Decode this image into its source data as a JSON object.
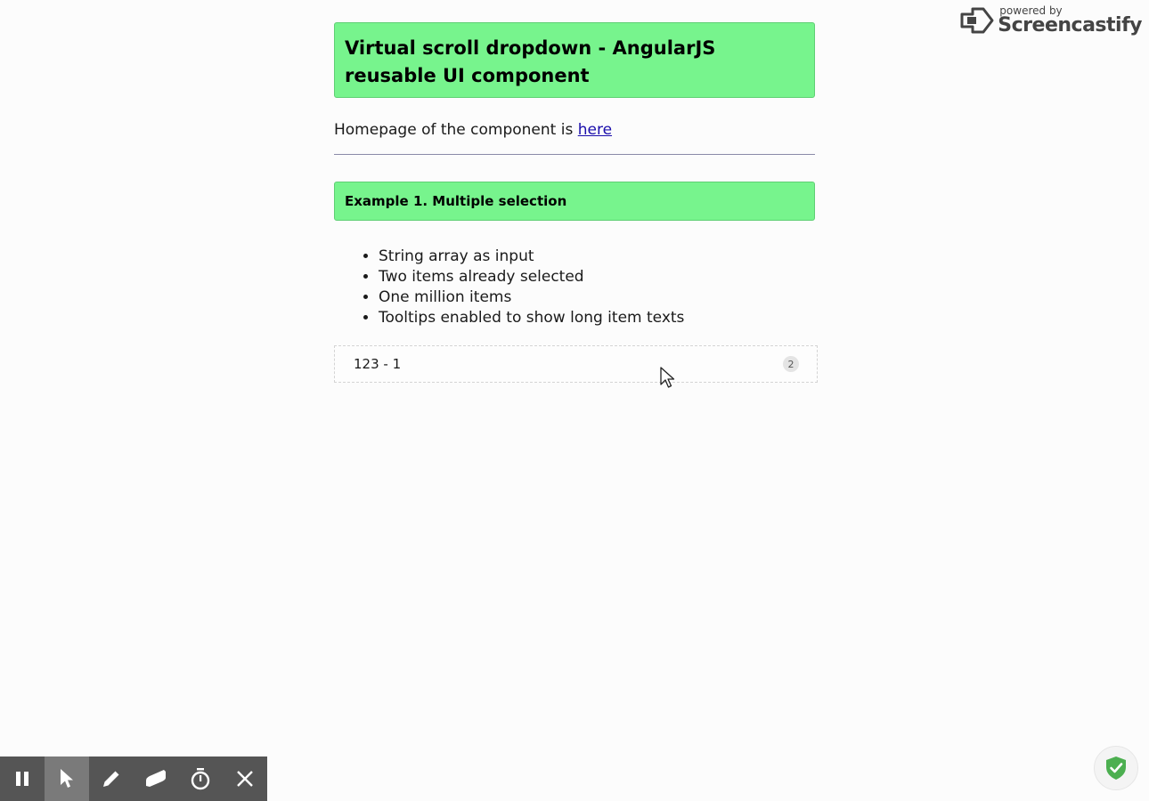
{
  "header": {
    "title": "Virtual scroll dropdown - AngularJS reusable UI component"
  },
  "homepage": {
    "text": "Homepage of the component is ",
    "link_label": "here"
  },
  "example1": {
    "heading": "Example 1. Multiple selection",
    "features": [
      "String array as input",
      "Two items already selected",
      "One million items",
      "Tooltips enabled to show long item texts"
    ],
    "dropdown": {
      "value": "123 - 1",
      "selected_count": "2"
    }
  },
  "watermark": {
    "small": "powered by",
    "brand": "Screencastify"
  },
  "toolbar": {
    "tools": [
      "pause-icon",
      "pointer-icon",
      "pen-icon",
      "eraser-icon",
      "timer-icon",
      "close-icon"
    ]
  },
  "colors": {
    "accent_green": "#77f48d",
    "link": "#1a0dab",
    "toolbar_bg": "#555555",
    "shield_green": "#4caf50"
  }
}
